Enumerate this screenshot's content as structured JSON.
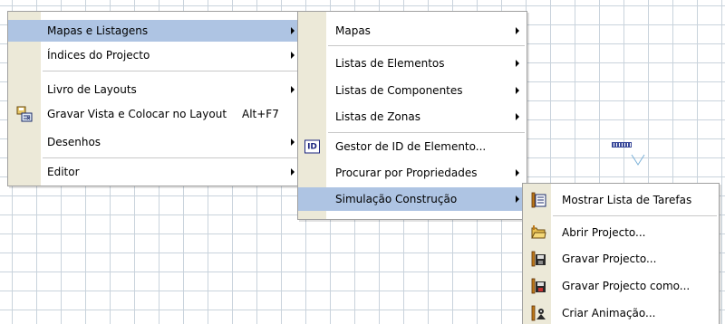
{
  "menu1": {
    "items": [
      {
        "label": "Mapas e Listagens",
        "submenu": true,
        "selected": true
      },
      {
        "label": "Índices do Projecto",
        "submenu": true
      },
      {
        "label": "Livro de Layouts",
        "submenu": true
      },
      {
        "label": "Gravar Vista e Colocar no Layout",
        "shortcut": "Alt+F7",
        "icon": "save-view-layout-icon"
      },
      {
        "label": "Desenhos",
        "submenu": true
      },
      {
        "label": "Editor",
        "submenu": true
      }
    ]
  },
  "menu2": {
    "items": [
      {
        "label": "Mapas",
        "submenu": true
      },
      {
        "label": "Listas de Elementos",
        "submenu": true
      },
      {
        "label": "Listas de Componentes",
        "submenu": true
      },
      {
        "label": "Listas de Zonas",
        "submenu": true
      },
      {
        "label": "Gestor de ID de Elemento...",
        "icon": "id-manager-icon",
        "icon_text": "ID"
      },
      {
        "label": "Procurar por Propriedades",
        "submenu": true
      },
      {
        "label": "Simulação Construção",
        "submenu": true,
        "selected": true
      }
    ]
  },
  "menu3": {
    "items": [
      {
        "label": "Mostrar Lista de Tarefas",
        "icon": "task-list-icon"
      },
      {
        "label": "Abrir Projecto...",
        "icon": "open-project-icon"
      },
      {
        "label": "Gravar Projecto...",
        "icon": "save-project-icon"
      },
      {
        "label": "Gravar Projecto como...",
        "icon": "save-project-as-icon"
      },
      {
        "label": "Criar Animação...",
        "icon": "create-animation-icon"
      }
    ]
  },
  "colors": {
    "highlight": "#aec4e3",
    "gutter": "#ece9d8",
    "grid": "#c9d3dc",
    "id_icon": "#1a237e"
  }
}
